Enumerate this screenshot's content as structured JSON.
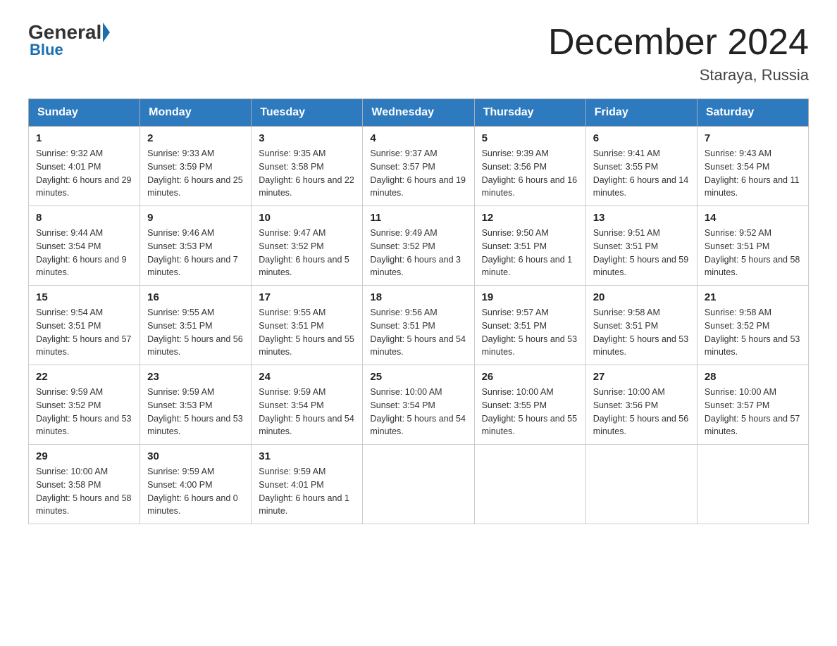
{
  "header": {
    "logo_general": "General",
    "logo_blue": "Blue",
    "month_title": "December 2024",
    "location": "Staraya, Russia"
  },
  "days_of_week": [
    "Sunday",
    "Monday",
    "Tuesday",
    "Wednesday",
    "Thursday",
    "Friday",
    "Saturday"
  ],
  "weeks": [
    [
      {
        "day": "1",
        "sunrise": "9:32 AM",
        "sunset": "4:01 PM",
        "daylight": "6 hours and 29 minutes."
      },
      {
        "day": "2",
        "sunrise": "9:33 AM",
        "sunset": "3:59 PM",
        "daylight": "6 hours and 25 minutes."
      },
      {
        "day": "3",
        "sunrise": "9:35 AM",
        "sunset": "3:58 PM",
        "daylight": "6 hours and 22 minutes."
      },
      {
        "day": "4",
        "sunrise": "9:37 AM",
        "sunset": "3:57 PM",
        "daylight": "6 hours and 19 minutes."
      },
      {
        "day": "5",
        "sunrise": "9:39 AM",
        "sunset": "3:56 PM",
        "daylight": "6 hours and 16 minutes."
      },
      {
        "day": "6",
        "sunrise": "9:41 AM",
        "sunset": "3:55 PM",
        "daylight": "6 hours and 14 minutes."
      },
      {
        "day": "7",
        "sunrise": "9:43 AM",
        "sunset": "3:54 PM",
        "daylight": "6 hours and 11 minutes."
      }
    ],
    [
      {
        "day": "8",
        "sunrise": "9:44 AM",
        "sunset": "3:54 PM",
        "daylight": "6 hours and 9 minutes."
      },
      {
        "day": "9",
        "sunrise": "9:46 AM",
        "sunset": "3:53 PM",
        "daylight": "6 hours and 7 minutes."
      },
      {
        "day": "10",
        "sunrise": "9:47 AM",
        "sunset": "3:52 PM",
        "daylight": "6 hours and 5 minutes."
      },
      {
        "day": "11",
        "sunrise": "9:49 AM",
        "sunset": "3:52 PM",
        "daylight": "6 hours and 3 minutes."
      },
      {
        "day": "12",
        "sunrise": "9:50 AM",
        "sunset": "3:51 PM",
        "daylight": "6 hours and 1 minute."
      },
      {
        "day": "13",
        "sunrise": "9:51 AM",
        "sunset": "3:51 PM",
        "daylight": "5 hours and 59 minutes."
      },
      {
        "day": "14",
        "sunrise": "9:52 AM",
        "sunset": "3:51 PM",
        "daylight": "5 hours and 58 minutes."
      }
    ],
    [
      {
        "day": "15",
        "sunrise": "9:54 AM",
        "sunset": "3:51 PM",
        "daylight": "5 hours and 57 minutes."
      },
      {
        "day": "16",
        "sunrise": "9:55 AM",
        "sunset": "3:51 PM",
        "daylight": "5 hours and 56 minutes."
      },
      {
        "day": "17",
        "sunrise": "9:55 AM",
        "sunset": "3:51 PM",
        "daylight": "5 hours and 55 minutes."
      },
      {
        "day": "18",
        "sunrise": "9:56 AM",
        "sunset": "3:51 PM",
        "daylight": "5 hours and 54 minutes."
      },
      {
        "day": "19",
        "sunrise": "9:57 AM",
        "sunset": "3:51 PM",
        "daylight": "5 hours and 53 minutes."
      },
      {
        "day": "20",
        "sunrise": "9:58 AM",
        "sunset": "3:51 PM",
        "daylight": "5 hours and 53 minutes."
      },
      {
        "day": "21",
        "sunrise": "9:58 AM",
        "sunset": "3:52 PM",
        "daylight": "5 hours and 53 minutes."
      }
    ],
    [
      {
        "day": "22",
        "sunrise": "9:59 AM",
        "sunset": "3:52 PM",
        "daylight": "5 hours and 53 minutes."
      },
      {
        "day": "23",
        "sunrise": "9:59 AM",
        "sunset": "3:53 PM",
        "daylight": "5 hours and 53 minutes."
      },
      {
        "day": "24",
        "sunrise": "9:59 AM",
        "sunset": "3:54 PM",
        "daylight": "5 hours and 54 minutes."
      },
      {
        "day": "25",
        "sunrise": "10:00 AM",
        "sunset": "3:54 PM",
        "daylight": "5 hours and 54 minutes."
      },
      {
        "day": "26",
        "sunrise": "10:00 AM",
        "sunset": "3:55 PM",
        "daylight": "5 hours and 55 minutes."
      },
      {
        "day": "27",
        "sunrise": "10:00 AM",
        "sunset": "3:56 PM",
        "daylight": "5 hours and 56 minutes."
      },
      {
        "day": "28",
        "sunrise": "10:00 AM",
        "sunset": "3:57 PM",
        "daylight": "5 hours and 57 minutes."
      }
    ],
    [
      {
        "day": "29",
        "sunrise": "10:00 AM",
        "sunset": "3:58 PM",
        "daylight": "5 hours and 58 minutes."
      },
      {
        "day": "30",
        "sunrise": "9:59 AM",
        "sunset": "4:00 PM",
        "daylight": "6 hours and 0 minutes."
      },
      {
        "day": "31",
        "sunrise": "9:59 AM",
        "sunset": "4:01 PM",
        "daylight": "6 hours and 1 minute."
      },
      null,
      null,
      null,
      null
    ]
  ]
}
